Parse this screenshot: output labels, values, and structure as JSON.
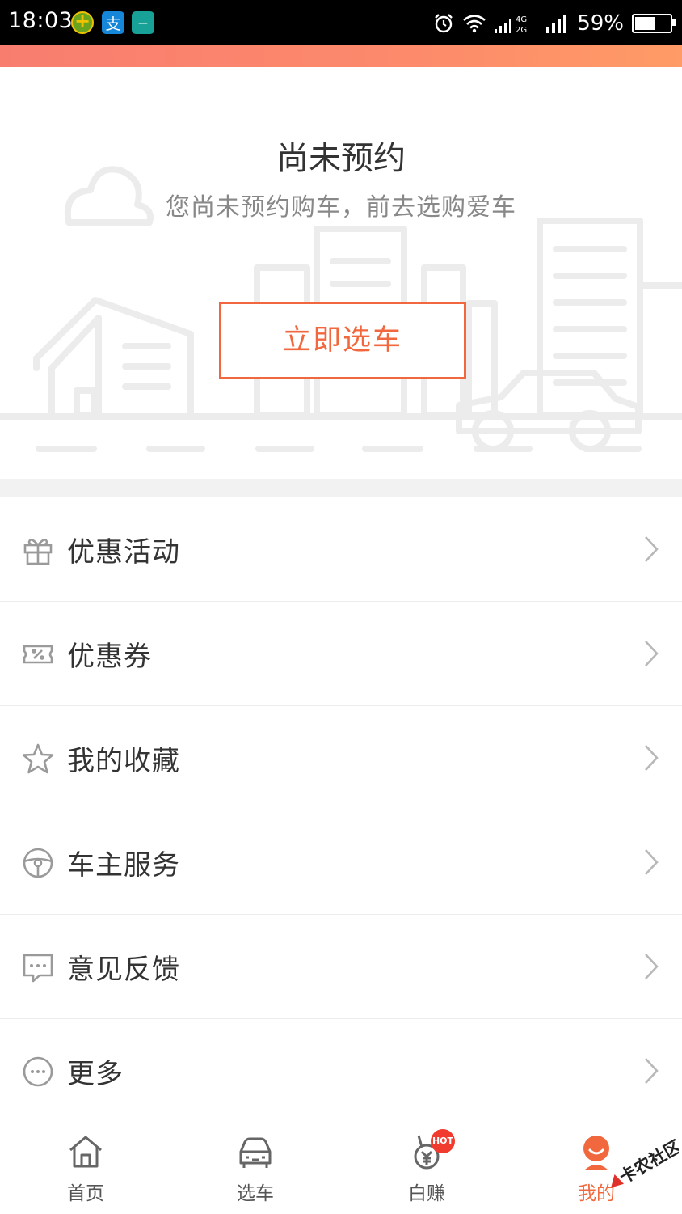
{
  "status_bar": {
    "time": "18:03",
    "battery": "59%",
    "battery_level": 0.59,
    "network": "4G 2G",
    "icons": [
      "app-icon",
      "alipay-icon",
      "scan-icon",
      "alarm-icon",
      "wifi-icon",
      "signal-icon",
      "battery-icon"
    ]
  },
  "empty_state": {
    "title": "尚未预约",
    "subtitle": "您尚未预约购车，前去选购爱车",
    "cta_label": "立即选车"
  },
  "menu": {
    "items": [
      {
        "label": "优惠活动",
        "icon": "gift-icon"
      },
      {
        "label": "优惠券",
        "icon": "coupon-icon"
      },
      {
        "label": "我的收藏",
        "icon": "star-icon"
      },
      {
        "label": "车主服务",
        "icon": "steering-wheel-icon"
      },
      {
        "label": "意见反馈",
        "icon": "feedback-icon"
      },
      {
        "label": "更多",
        "icon": "more-icon"
      }
    ]
  },
  "bottom_nav": {
    "items": [
      {
        "label": "首页",
        "icon": "home-icon"
      },
      {
        "label": "选车",
        "icon": "car-icon"
      },
      {
        "label": "白赚",
        "icon": "medal-icon",
        "badge": "HOT"
      },
      {
        "label": "我的",
        "icon": "profile-icon",
        "active": true
      }
    ]
  },
  "colors": {
    "accent": "#f2683e",
    "strip_start": "#f87d6f",
    "strip_end": "#ff9b66",
    "hot_badge": "#f23b2f"
  },
  "watermark": "卡农社区"
}
